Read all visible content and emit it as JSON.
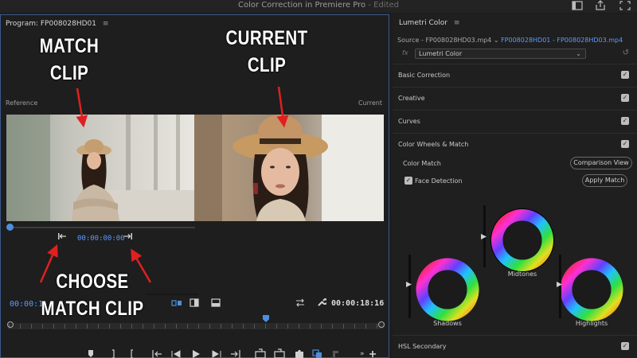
{
  "window": {
    "title": "Color Correction in Premiere Pro",
    "edited": " - Edited"
  },
  "program": {
    "tab_label": "Program: FP008028HD01",
    "menu_glyph": "≡",
    "reference_label": "Reference",
    "current_label": "Current",
    "match_timecode": "00:00:00:00",
    "left_timecode": "00:00:1",
    "right_timecode": "00:00:18:16",
    "overlays": {
      "match_line1": "MATCH",
      "match_line2": "CLIP",
      "current_line1": "CURRENT",
      "current_line2": "CLIP",
      "choose_line1": "CHOOSE",
      "choose_line2": "MATCH CLIP"
    },
    "transport_icons": [
      "marker-icon",
      "mark-in-icon",
      "mark-out-icon",
      "go-to-in-icon",
      "step-back-icon",
      "play-icon",
      "step-forward-icon",
      "go-to-out-icon",
      "lift-icon",
      "extract-icon",
      "export-frame-icon",
      "comparison-view-icon",
      "trim-icon",
      "add-icon"
    ]
  },
  "lumetri": {
    "tab_label": "Lumetri Color",
    "menu_glyph": "≡",
    "source_prefix": "Source - FP008028HD03.mp4",
    "source_active": "FP008028HD01 - FP008028HD03.mp4",
    "fx_label": "fx",
    "effect_select": "Lumetri Color",
    "sections": [
      {
        "label": "Basic Correction",
        "checked": true
      },
      {
        "label": "Creative",
        "checked": true
      },
      {
        "label": "Curves",
        "checked": true
      },
      {
        "label": "Color Wheels & Match",
        "checked": true
      }
    ],
    "color_match_label": "Color Match",
    "comparison_view_button": "Comparison View",
    "face_detection_label": "Face Detection",
    "face_detection_checked": true,
    "apply_match_button": "Apply Match",
    "wheels": {
      "midtones": "Midtones",
      "shadows": "Shadows",
      "highlights": "Highlights"
    },
    "hsl_secondary": "HSL Secondary"
  }
}
